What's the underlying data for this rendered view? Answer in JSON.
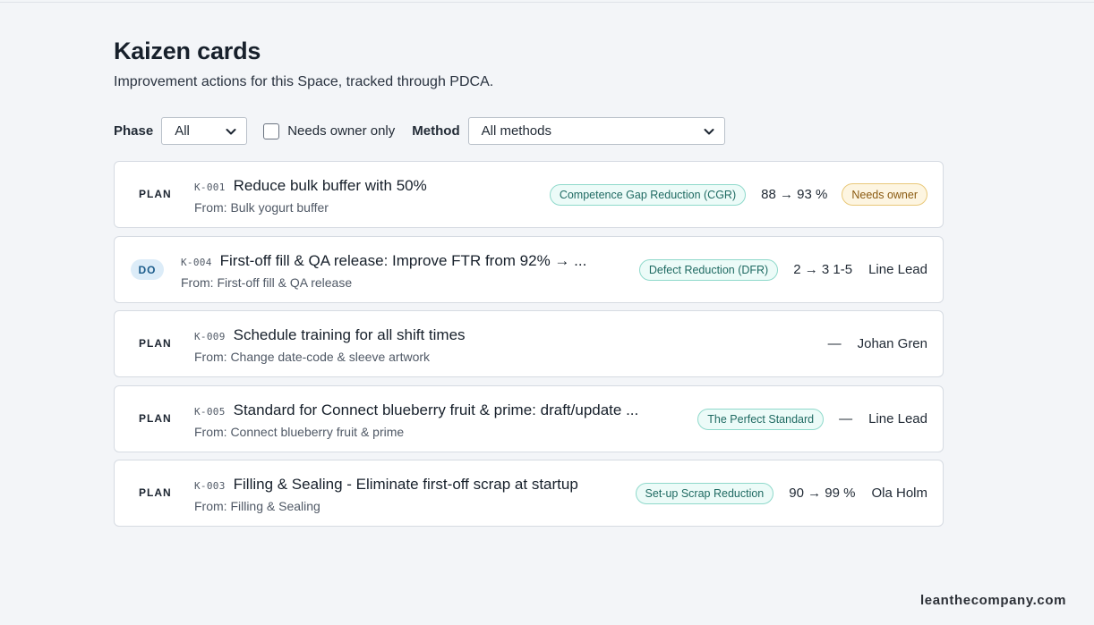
{
  "header": {
    "title": "Kaizen cards",
    "subtitle": "Improvement actions for this Space, tracked through PDCA."
  },
  "filters": {
    "phase_label": "Phase",
    "phase_value": "All",
    "needs_owner_label": "Needs owner only",
    "needs_owner_checked": false,
    "method_label": "Method",
    "method_value": "All methods"
  },
  "cards": [
    {
      "phase": "PLAN",
      "id": "K-001",
      "title": "Reduce bulk buffer with 50%",
      "from": "From: Bulk yogurt buffer",
      "method": "Competence Gap Reduction (CGR)",
      "metric": "88 → 93 %",
      "owner": "",
      "needs_owner": "Needs owner"
    },
    {
      "phase": "DO",
      "id": "K-004",
      "title": "First-off fill & QA release: Improve FTR from 92% → ...",
      "from": "From: First-off fill & QA release",
      "method": "Defect Reduction (DFR)",
      "metric": "2 → 3 1-5",
      "owner": "Line Lead",
      "needs_owner": ""
    },
    {
      "phase": "PLAN",
      "id": "K-009",
      "title": "Schedule training for all shift times",
      "from": "From: Change date-code & sleeve artwork",
      "method": "",
      "metric": "—",
      "owner": "Johan Gren",
      "needs_owner": ""
    },
    {
      "phase": "PLAN",
      "id": "K-005",
      "title": "Standard for Connect blueberry fruit & prime: draft/update ...",
      "from": "From: Connect blueberry fruit & prime",
      "method": "The Perfect Standard",
      "metric": "—",
      "owner": "Line Lead",
      "needs_owner": ""
    },
    {
      "phase": "PLAN",
      "id": "K-003",
      "title": "Filling & Sealing - Eliminate first-off scrap at startup",
      "from": "From: Filling & Sealing",
      "method": "Set-up Scrap Reduction",
      "metric": "90 → 99 %",
      "owner": "Ola Holm",
      "needs_owner": ""
    }
  ],
  "footer": {
    "watermark": "leanthecompany.com"
  },
  "icons": {
    "dropdown": "chevron-down-icon"
  },
  "colors": {
    "background": "#f3f5f8",
    "method_chip_bg": "#ecfbf8",
    "method_chip_border": "#8fd9cb",
    "needs_owner_bg": "#fdf5e1",
    "needs_owner_border": "#e9c879",
    "do_badge_bg": "#dcecf8"
  }
}
